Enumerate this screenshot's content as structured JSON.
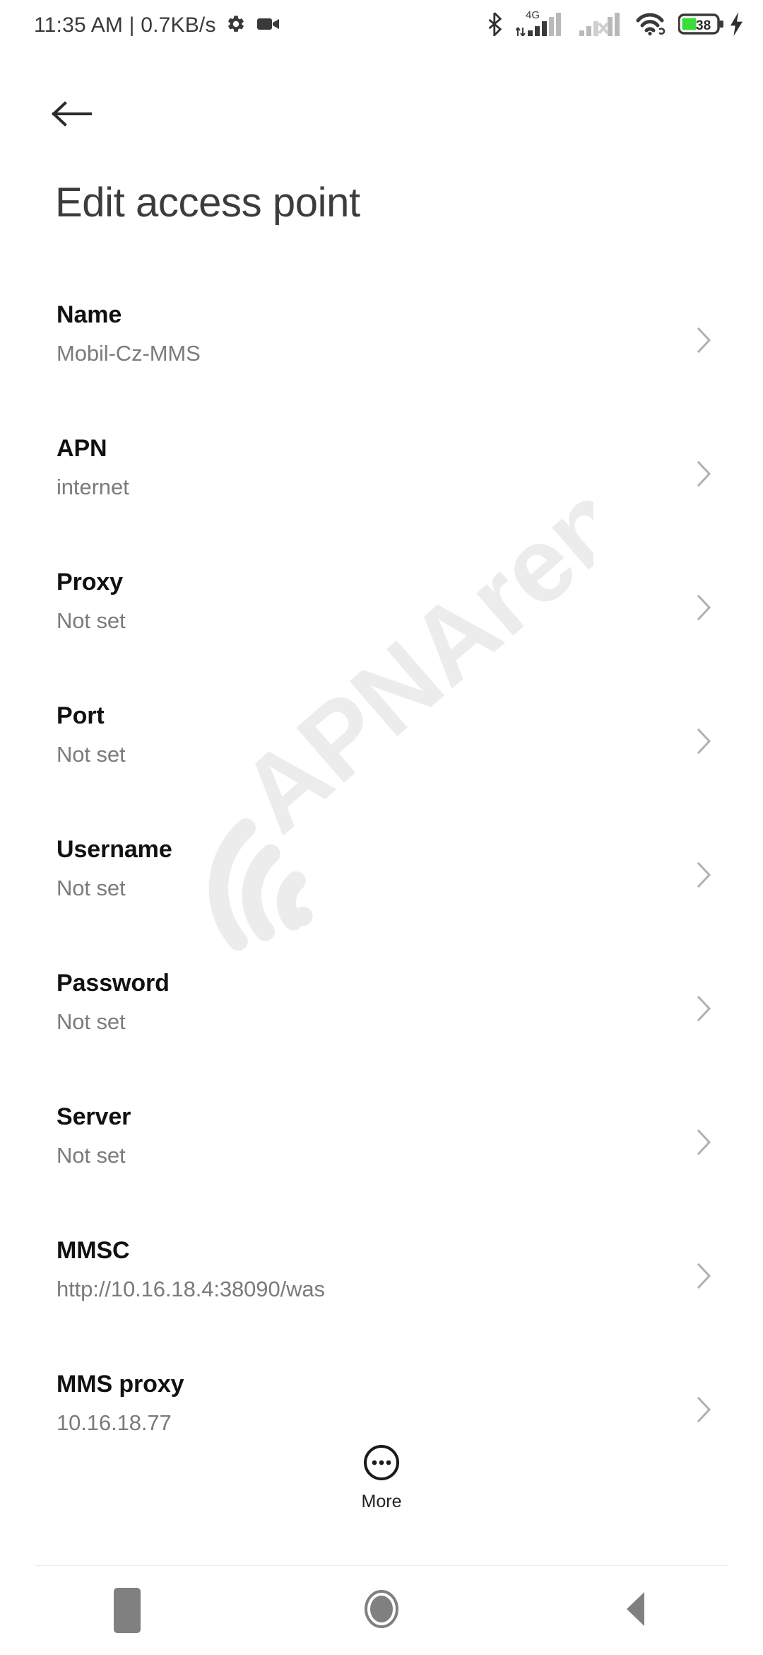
{
  "statusbar": {
    "clock": "11:35 AM | 0.7KB/s",
    "gear_icon": "gear-icon",
    "camera_icon": "video-camera-icon",
    "bluetooth_icon": "bluetooth-icon",
    "network_type": "4G",
    "sim1_icon": "signal-bars-sim1-icon",
    "sim2_icon": "signal-bars-sim2-no-service-icon",
    "wifi_icon": "wifi-icon",
    "battery_level": "38",
    "battery_icon": "battery-icon",
    "charging_icon": "charging-bolt-icon",
    "battery_color": "#3ddc3d"
  },
  "navigation": {
    "back_arrow_icon": "back-arrow-icon"
  },
  "header": {
    "title": "Edit access point"
  },
  "watermark": {
    "text": "APNArena",
    "icon": "wifi-watermark-icon",
    "color": "#ececec"
  },
  "list": {
    "rows": [
      {
        "title": "Name",
        "value": "Mobil-Cz-MMS",
        "chevron": "chevron-right-icon"
      },
      {
        "title": "APN",
        "value": "internet",
        "chevron": "chevron-right-icon"
      },
      {
        "title": "Proxy",
        "value": "Not set",
        "chevron": "chevron-right-icon"
      },
      {
        "title": "Port",
        "value": "Not set",
        "chevron": "chevron-right-icon"
      },
      {
        "title": "Username",
        "value": "Not set",
        "chevron": "chevron-right-icon"
      },
      {
        "title": "Password",
        "value": "Not set",
        "chevron": "chevron-right-icon"
      },
      {
        "title": "Server",
        "value": "Not set",
        "chevron": "chevron-right-icon"
      },
      {
        "title": "MMSC",
        "value": "http://10.16.18.4:38090/was",
        "chevron": "chevron-right-icon"
      },
      {
        "title": "MMS proxy",
        "value": "10.16.18.77",
        "chevron": "chevron-right-icon"
      }
    ]
  },
  "more_button": {
    "label": "More",
    "icon": "more-dots-circle-icon"
  },
  "navbar": {
    "recents_icon": "recents-square-icon",
    "home_icon": "home-circle-icon",
    "back_icon": "back-triangle-icon",
    "color": "#808080"
  }
}
